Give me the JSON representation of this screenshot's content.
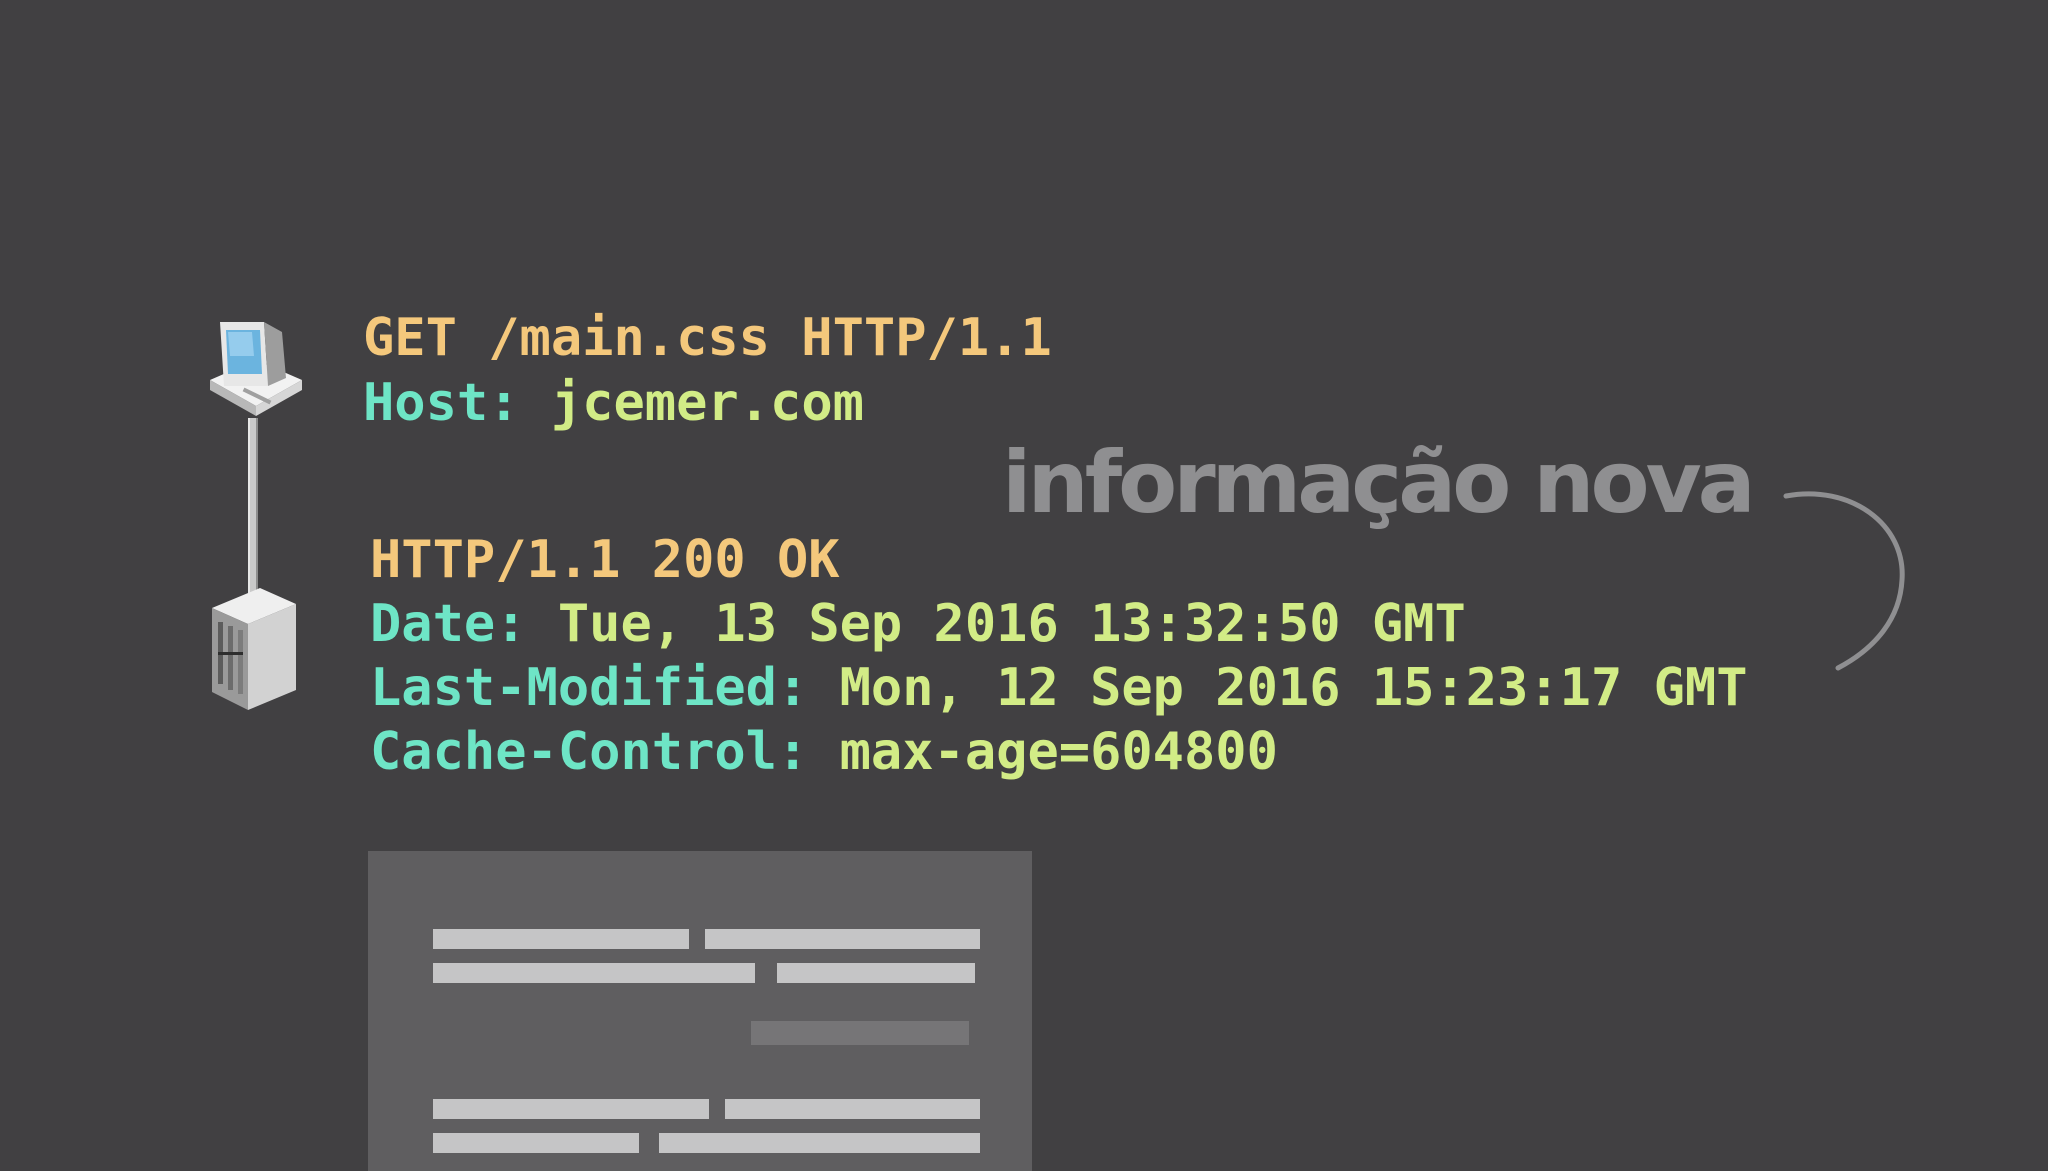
{
  "request": {
    "first_line": "GET /main.css HTTP/1.1",
    "headers": [
      {
        "name": "Host:",
        "value": "jcemer.com"
      }
    ]
  },
  "response": {
    "status_line": "HTTP/1.1 200 OK",
    "headers": [
      {
        "name": "Date:",
        "value": "Tue, 13 Sep 2016 13:32:50 GMT"
      },
      {
        "name": "Last-Modified:",
        "value": "Mon, 12 Sep 2016 15:23:17 GMT"
      },
      {
        "name": "Cache-Control:",
        "value": "max-age=604800"
      }
    ]
  },
  "annotation": "informação nova",
  "icons": {
    "client": "computer-icon",
    "server": "server-icon",
    "arrow": "curved-arrow-icon",
    "document": "document-icon"
  },
  "colors": {
    "background": "#414042",
    "first_line": "#f4c87c",
    "header_name": "#6ee5c6",
    "header_value": "#d2ec86",
    "annotation": "#8f8f91",
    "document": "#5f5e60"
  }
}
